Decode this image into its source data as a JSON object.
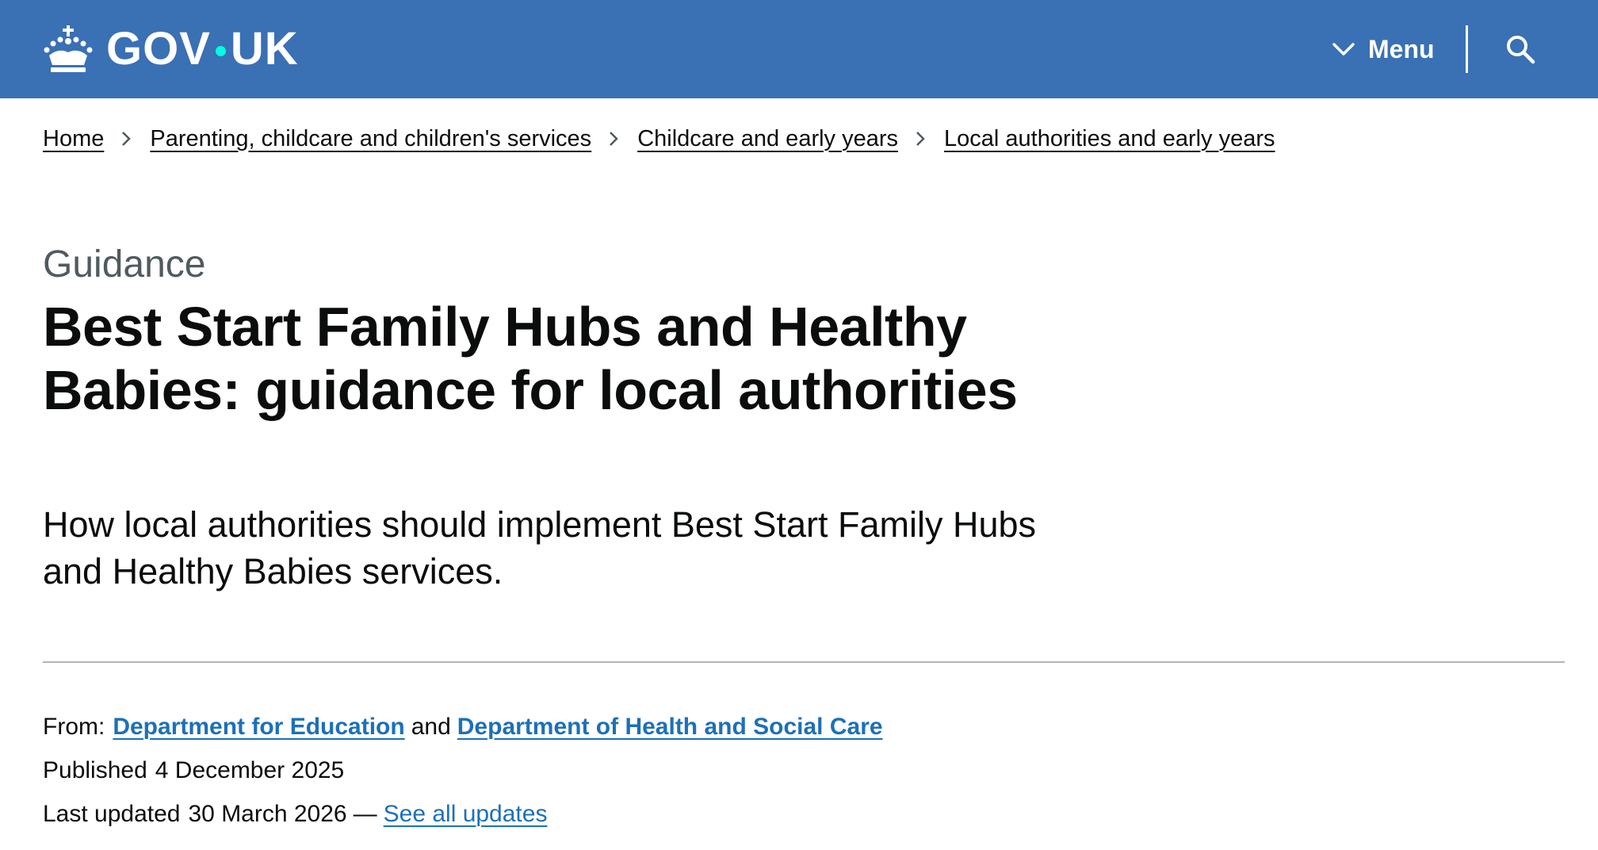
{
  "header": {
    "logo_icon": "crown-icon",
    "logo_left": "GOV",
    "logo_right": "UK",
    "menu_label": "Menu",
    "menu_icon": "chevron-down-icon",
    "search_icon": "search-icon",
    "background_color": "#3a70b4",
    "dot_color": "#00ffe0"
  },
  "breadcrumbs": [
    {
      "label": "Home"
    },
    {
      "label": "Parenting, childcare and children's services"
    },
    {
      "label": "Childcare and early years"
    },
    {
      "label": "Local authorities and early years"
    }
  ],
  "page": {
    "caption": "Guidance",
    "title": "Best Start Family Hubs and Healthy Babies: guidance for local authorities",
    "lead": "How local authorities should implement Best Start Family Hubs and Healthy Babies services."
  },
  "metadata": {
    "from_label": "From:",
    "organisations": [
      "Department for Education",
      "Department of Health and Social Care"
    ],
    "conjunction": "and",
    "published_label": "Published",
    "published_date": "4 December 2025",
    "updated_label": "Last updated",
    "updated_date": "30 March 2026",
    "updated_separator": "—",
    "see_all_updates": "See all updates",
    "link_color": "#1d70b8"
  }
}
